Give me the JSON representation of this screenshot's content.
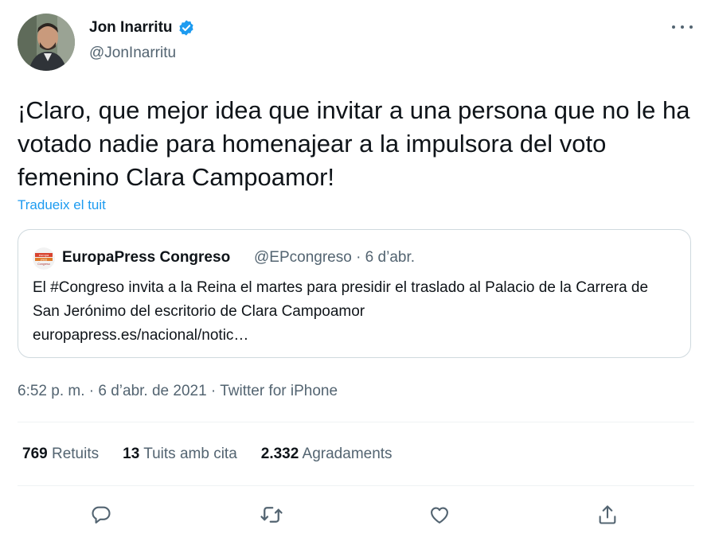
{
  "tweet": {
    "author": {
      "display_name": "Jon Inarritu",
      "handle": "@JonInarritu",
      "verified": true
    },
    "text": "¡Claro, que mejor idea que invitar a una persona que no le ha votado nadie para homenajear a la impulsora del voto femenino Clara Campoamor!",
    "translate_link": "Tradueix el tuit",
    "quoted": {
      "display_name": "EuropaPress Congreso",
      "meta": "@EPcongreso · 6 d’abr.",
      "text": "El #Congreso invita a la Reina el martes para presidir el traslado al Palacio de la Carrera de San Jerónimo del escritorio de Clara Campoamor",
      "link": "europapress.es/nacional/notic…",
      "logo_text": [
        "europa",
        "press",
        "Congreso"
      ]
    },
    "timestamp_line": "6:52 p. m. · 6 d’abr. de 2021 · Twitter for iPhone",
    "stats": {
      "retweets_count": "769",
      "retweets_label": "Retuits",
      "quotes_count": "13",
      "quotes_label": "Tuits amb cita",
      "likes_count": "2.332",
      "likes_label": "Agradaments"
    },
    "actions": [
      "reply-icon",
      "retweet-icon",
      "like-icon",
      "share-icon"
    ]
  },
  "colors": {
    "accent": "#1d9bf0",
    "text": "#0f1419",
    "secondary": "#536471",
    "border": "#cfd9de",
    "divider": "#eff3f4"
  }
}
